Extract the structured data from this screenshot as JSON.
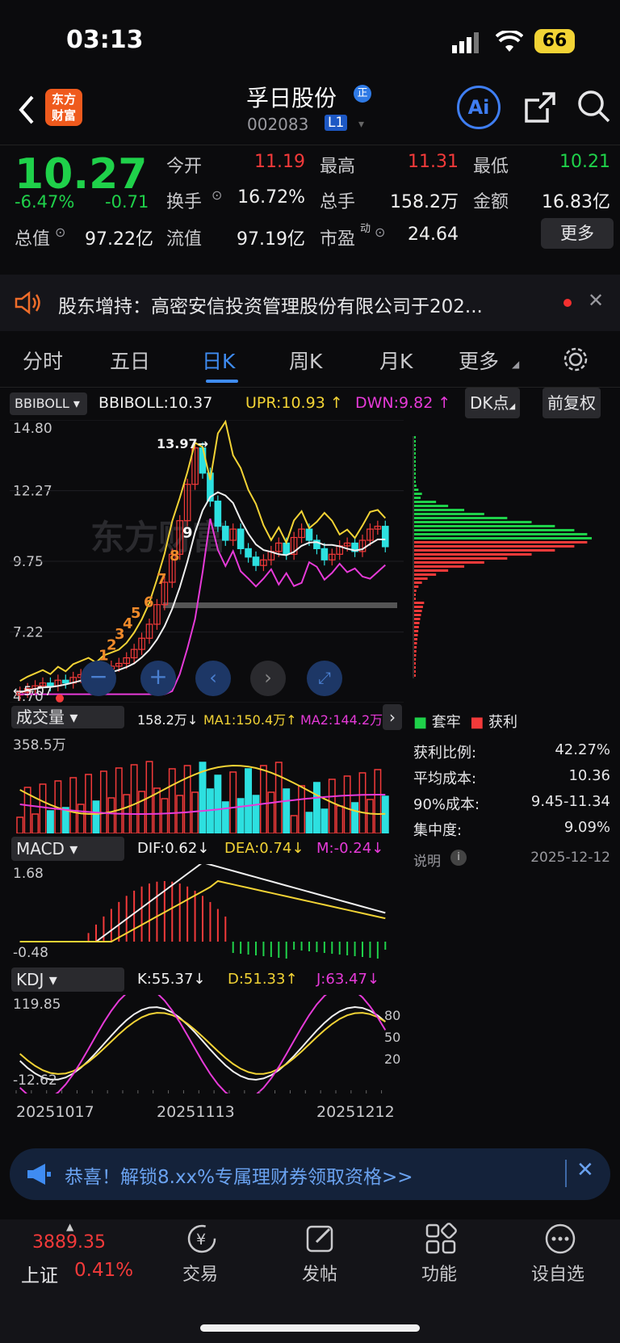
{
  "status": {
    "time": "03:13",
    "battery": "66"
  },
  "header": {
    "name": "孚日股份",
    "code": "002083",
    "level": "L1",
    "badge": "正",
    "logo_top": "东方",
    "logo_bottom": "财富",
    "ai": "Ai"
  },
  "quote": {
    "price": "10.27",
    "pct": "-6.47%",
    "chg": "-0.71",
    "open_l": "今开",
    "open": "11.19",
    "high_l": "最高",
    "high": "11.31",
    "low_l": "最低",
    "low": "10.21",
    "turn_l": "换手",
    "turn": "16.72%",
    "vol_l": "总手",
    "vol": "158.2万",
    "amt_l": "金额",
    "amt": "16.83亿",
    "cap_l": "总值",
    "cap": "97.22亿",
    "float_l": "流值",
    "float": "97.19亿",
    "pe_l": "市盈",
    "pe_sup": "动",
    "pe": "24.64",
    "more": "更多"
  },
  "notice": {
    "text": "股东增持：高密安信投资管理股份有限公司于202..."
  },
  "tabs": [
    "分时",
    "五日",
    "日K",
    "周K",
    "月K",
    "更多"
  ],
  "indicator": {
    "sel": "BBIBOLL",
    "bbi": "BBIBOLL:10.37",
    "upr": "UPR:10.93",
    "dwn": "DWN:9.82",
    "dk": "DK点",
    "adj": "前复权"
  },
  "price_axis": [
    "14.80",
    "12.27",
    "9.75",
    "7.22",
    "4.70"
  ],
  "annot": {
    "high": "13.97",
    "low": "5.07"
  },
  "td_seq": [
    "1",
    "2",
    "3",
    "4",
    "5",
    "6",
    "7",
    "8",
    "9"
  ],
  "volume": {
    "sel": "成交量",
    "v": "158.2万",
    "ma1": "MA1:150.4万",
    "ma2": "MA2:144.2万",
    "max": "358.5万"
  },
  "macd": {
    "sel": "MACD",
    "dif": "DIF:0.62",
    "dea": "DEA:0.74",
    "m": "M:-0.24",
    "top": "1.68",
    "bot": "-0.48"
  },
  "kdj": {
    "sel": "KDJ",
    "k": "K:55.37",
    "d": "D:51.33",
    "j": "J:63.47",
    "top": "119.85",
    "bot": "-12.62",
    "l80": "80",
    "l50": "50",
    "l20": "20"
  },
  "dates": [
    "20251017",
    "20251113",
    "20251212"
  ],
  "chips": {
    "trap": "套牢",
    "profit": "获利",
    "ratio_l": "获利比例:",
    "ratio": "42.27%",
    "avg_l": "平均成本:",
    "avg": "10.36",
    "c90_l": "90%成本:",
    "c90": "9.45-11.34",
    "conc_l": "集中度:",
    "conc": "9.09%",
    "note": "说明",
    "date": "2025-12-12"
  },
  "ad": {
    "text": "恭喜！解锁8.xx%专属理财券领取资格>>"
  },
  "bottom": {
    "index": "3889.35",
    "index_name": "上证",
    "index_pct": "0.41%",
    "items": [
      "交易",
      "发帖",
      "功能",
      "设自选"
    ]
  },
  "colors": {
    "up": "#f33a3a",
    "down": "#1fd14a",
    "cyan": "#2de0e0",
    "yellow": "#f2d335",
    "magenta": "#e63ad8"
  }
}
